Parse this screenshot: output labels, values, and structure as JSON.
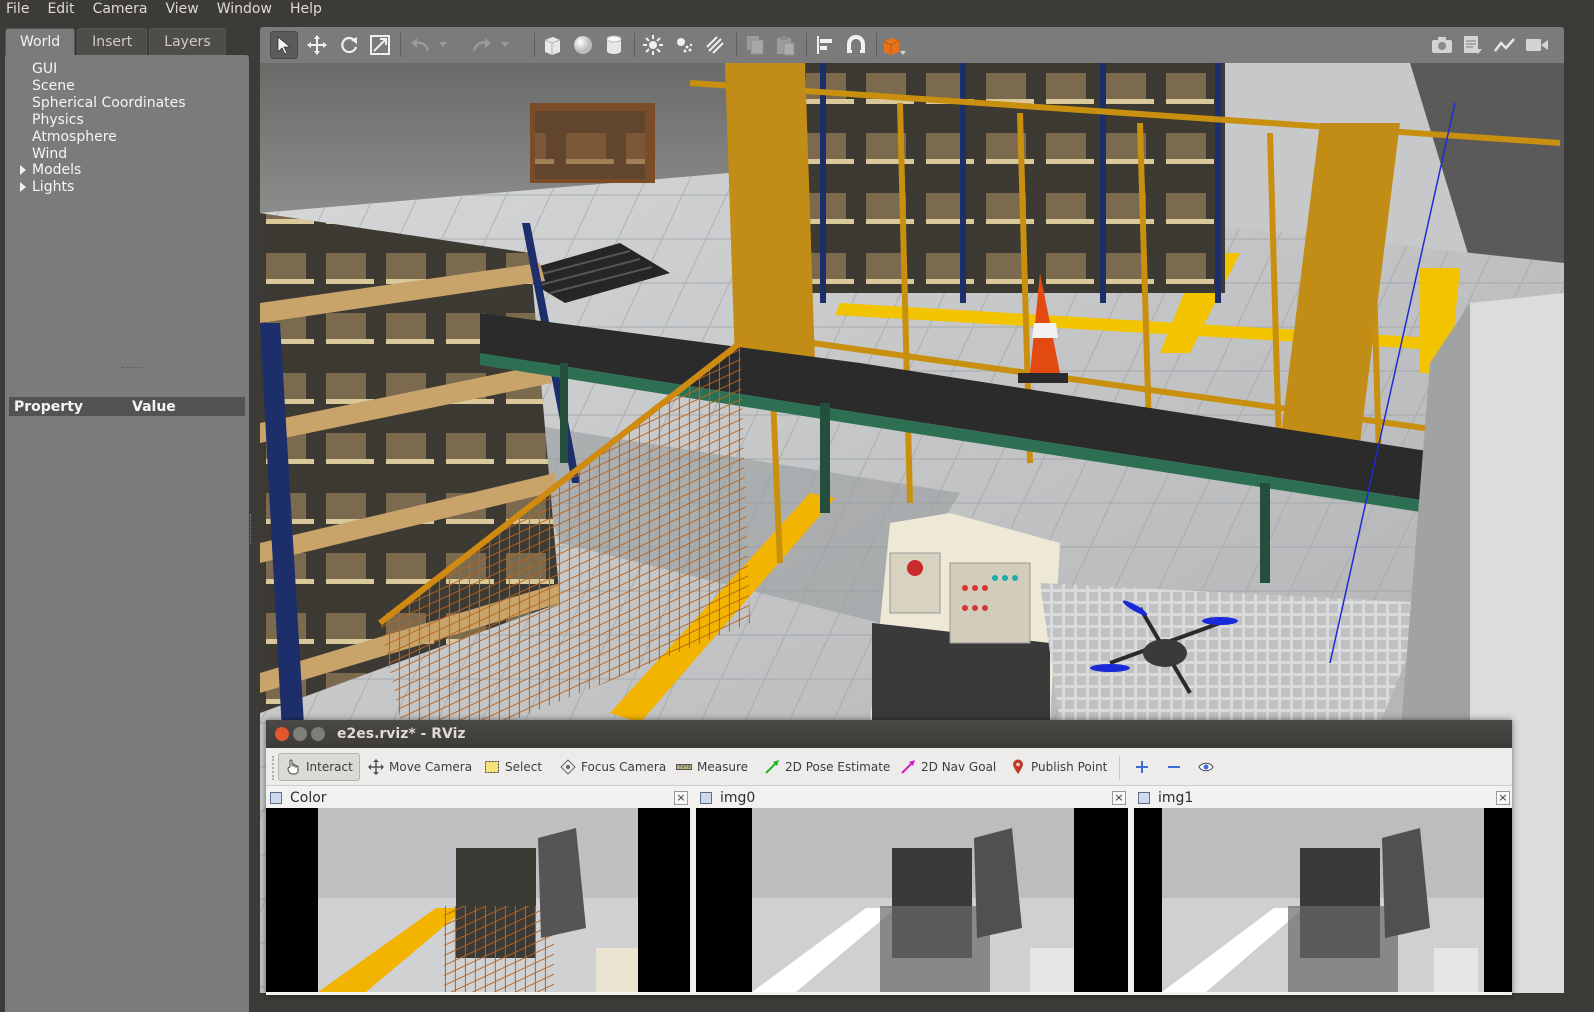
{
  "menu": [
    "File",
    "Edit",
    "Camera",
    "View",
    "Window",
    "Help"
  ],
  "left_panel": {
    "tabs": [
      "World",
      "Insert",
      "Layers"
    ],
    "active_tab": "World",
    "tree": [
      {
        "label": "GUI",
        "expandable": false
      },
      {
        "label": "Scene",
        "expandable": false
      },
      {
        "label": "Spherical Coordinates",
        "expandable": false
      },
      {
        "label": "Physics",
        "expandable": false
      },
      {
        "label": "Atmosphere",
        "expandable": false
      },
      {
        "label": "Wind",
        "expandable": false
      },
      {
        "label": "Models",
        "expandable": true
      },
      {
        "label": "Lights",
        "expandable": true
      }
    ],
    "property_header": {
      "property": "Property",
      "value": "Value"
    }
  },
  "gazebo_toolbar": {
    "tools": [
      "select-mode-icon",
      "translate-mode-icon",
      "rotate-mode-icon",
      "scale-mode-icon",
      "undo-icon",
      "redo-icon",
      "box-shape-icon",
      "sphere-shape-icon",
      "cylinder-shape-icon",
      "point-light-icon",
      "spot-light-icon",
      "directional-light-icon",
      "copy-icon",
      "paste-icon",
      "align-icon",
      "snap-icon",
      "view-angle-icon",
      "screenshot-icon",
      "log-icon",
      "plot-icon",
      "video-record-icon"
    ],
    "accent": "#e8731a"
  },
  "rviz": {
    "title": "e2es.rviz* - RViz",
    "tools": [
      {
        "label": "Interact",
        "active": true,
        "color": "#555555"
      },
      {
        "label": "Move Camera",
        "active": false,
        "color": "#555555"
      },
      {
        "label": "Select",
        "active": false,
        "color": "#c9a227"
      },
      {
        "label": "Focus Camera",
        "active": false,
        "color": "#555555"
      },
      {
        "label": "Measure",
        "active": false,
        "color": "#6b6b3a"
      },
      {
        "label": "2D Pose Estimate",
        "active": false,
        "color": "#25b425"
      },
      {
        "label": "2D Nav Goal",
        "active": false,
        "color": "#d01fc9"
      },
      {
        "label": "Publish Point",
        "active": false,
        "color": "#c0392b"
      }
    ],
    "panels": [
      {
        "title": "Color",
        "mode": "color"
      },
      {
        "title": "img0",
        "mode": "gray"
      },
      {
        "title": "img1",
        "mode": "gray"
      }
    ],
    "close_glyph": "×"
  }
}
